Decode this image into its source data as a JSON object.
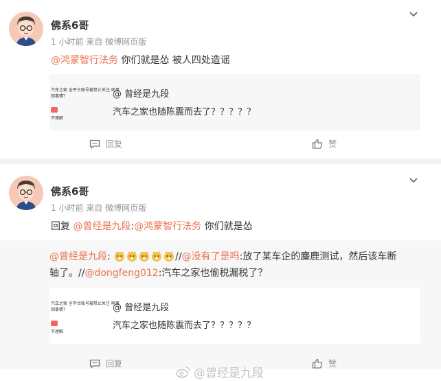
{
  "post1": {
    "author": "佛系6哥",
    "meta": "1 小时前  来自 微博网页版",
    "mention": "@鸿蒙智行法务",
    "text": " 你们就是怂  被人四处造谣",
    "quote": {
      "thumb_title": "汽车之家 全平台账号被禁止关注 啥事",
      "thumb_sub": "回事情？",
      "thumb_reply": "不理解",
      "title": "@ 曾经是九段",
      "text": "汽车之家也随陈震而去了？？？？？"
    },
    "comment_label": "回复",
    "like_label": "赞"
  },
  "post2": {
    "author": "佛系6哥",
    "meta": "1 小时前  来自 微博网页版",
    "reply_prefix": "回复",
    "mention1": "@曾经是九段",
    "sep": ":",
    "mention2": "@鸿蒙智行法务",
    "text": " 你们就是怂",
    "repost": {
      "mention1": "@曾经是九段",
      "colon1": ":",
      "sep1": "//",
      "mention2": "@没有了是吗",
      "text1": ":放了某车企的麋鹿测试，然后该车断",
      "line2_prefix": "轴了。//",
      "mention3": "@dongfeng012",
      "text2": ":汽车之家也偷税漏税了？"
    },
    "quote": {
      "thumb_title": "汽车之家 全平台账号被禁止关注 啥事",
      "thumb_sub": "回事情？",
      "thumb_reply": "不理解",
      "title": "@ 曾经是九段",
      "text": "汽车之家也随陈震而去了？？？？？"
    },
    "comment_label": "回复",
    "like_label": "赞"
  },
  "watermark": "@曾经是九段",
  "colors": {
    "link": "#eb7350",
    "meta": "#939393",
    "background": "#f1f2f5"
  }
}
